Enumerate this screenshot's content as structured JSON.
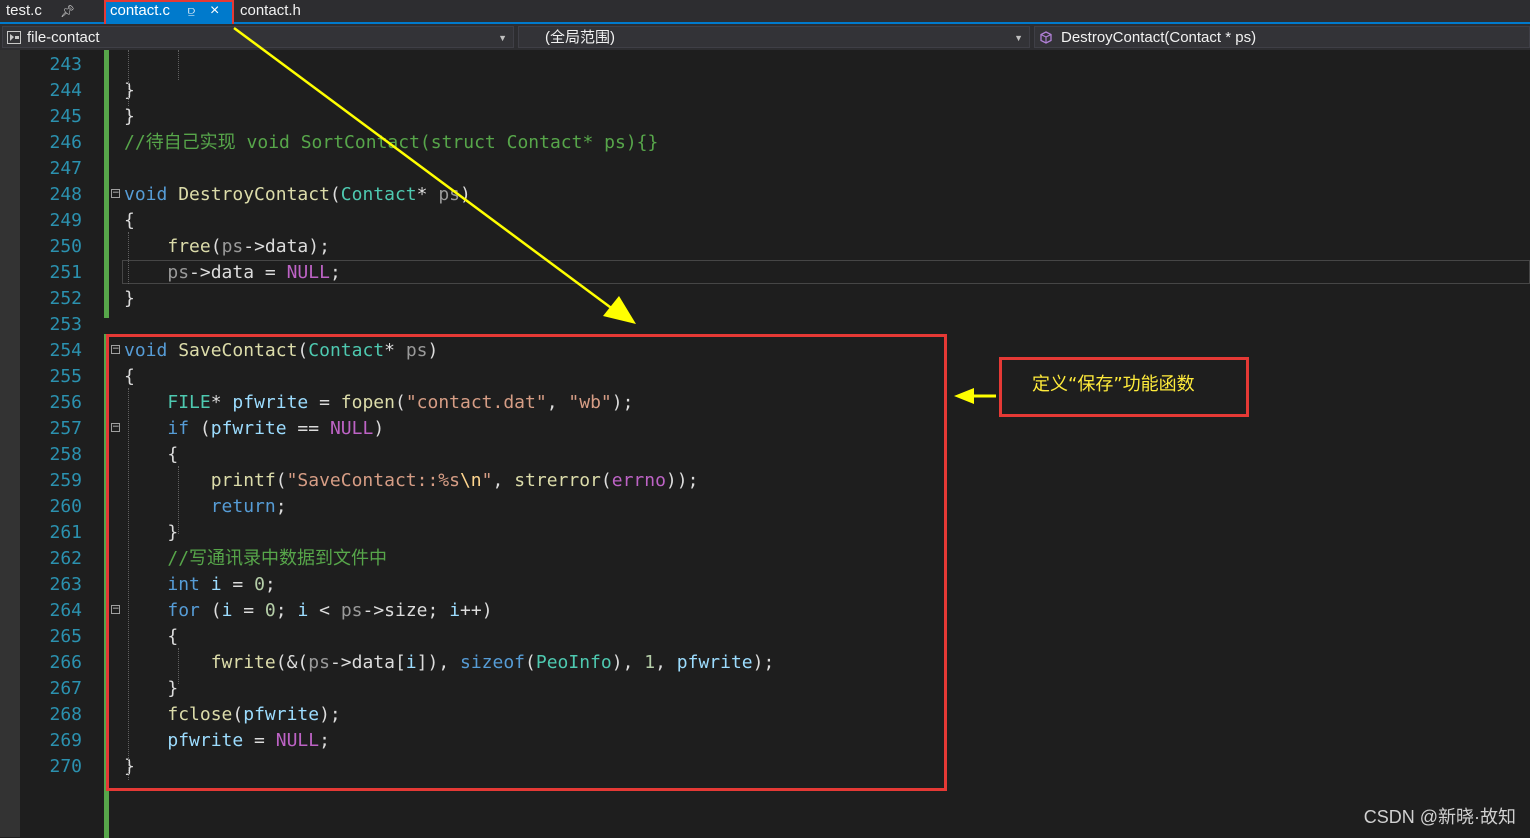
{
  "tabs": [
    {
      "label": "test.c",
      "pin": "pin-icon"
    },
    {
      "label": "contact.c",
      "pin": "pin-icon",
      "close": "×",
      "active": true
    },
    {
      "label": "contact.h"
    }
  ],
  "navbar": {
    "project": "file-contact",
    "scope": "(全局范围)",
    "member": "DestroyContact(Contact * ps)"
  },
  "annotation": {
    "callout": "定义“保存”功能函数"
  },
  "watermark": "CSDN @新晓·故知",
  "colors": {
    "accent": "#007acc",
    "highlight_box": "#e53935",
    "arrow": "#ffff00",
    "callout_text": "#ffeb3b"
  },
  "code_lines": [
    {
      "num": "243",
      "tokens": []
    },
    {
      "num": "244",
      "tokens": [
        {
          "t": "pl",
          "v": "}"
        }
      ]
    },
    {
      "num": "245",
      "tokens": [
        {
          "t": "pl",
          "v": "}"
        }
      ]
    },
    {
      "num": "246",
      "tokens": [
        {
          "t": "cm",
          "v": "//"
        },
        {
          "t": "cm",
          "v": "待自己实现",
          "cjk": true
        },
        {
          "t": "cm",
          "v": " void SortContact(struct Contact* ps){}"
        }
      ]
    },
    {
      "num": "247",
      "tokens": []
    },
    {
      "num": "248",
      "fold": true,
      "tokens": [
        {
          "t": "kw",
          "v": "void"
        },
        {
          "t": "pl",
          "v": " "
        },
        {
          "t": "fn",
          "v": "DestroyContact"
        },
        {
          "t": "pl",
          "v": "("
        },
        {
          "t": "ty",
          "v": "Contact"
        },
        {
          "t": "pl",
          "v": "* "
        },
        {
          "t": "pa",
          "v": "ps"
        },
        {
          "t": "pl",
          "v": ")"
        }
      ]
    },
    {
      "num": "249",
      "tokens": [
        {
          "t": "pl",
          "v": "{"
        }
      ]
    },
    {
      "num": "250",
      "tokens": [
        {
          "t": "pl",
          "v": "    "
        },
        {
          "t": "fn",
          "v": "free"
        },
        {
          "t": "pl",
          "v": "("
        },
        {
          "t": "pa",
          "v": "ps"
        },
        {
          "t": "pl",
          "v": "->data);"
        }
      ]
    },
    {
      "num": "251",
      "tokens": [
        {
          "t": "pl",
          "v": "    "
        },
        {
          "t": "pa",
          "v": "ps"
        },
        {
          "t": "pl",
          "v": "->data = "
        },
        {
          "t": "ma",
          "v": "NULL"
        },
        {
          "t": "pl",
          "v": ";"
        }
      ]
    },
    {
      "num": "252",
      "tokens": [
        {
          "t": "pl",
          "v": "}"
        }
      ]
    },
    {
      "num": "253",
      "tokens": []
    },
    {
      "num": "254",
      "fold": true,
      "tokens": [
        {
          "t": "kw",
          "v": "void"
        },
        {
          "t": "pl",
          "v": " "
        },
        {
          "t": "fn",
          "v": "SaveContact"
        },
        {
          "t": "pl",
          "v": "("
        },
        {
          "t": "ty",
          "v": "Contact"
        },
        {
          "t": "pl",
          "v": "* "
        },
        {
          "t": "pa",
          "v": "ps"
        },
        {
          "t": "pl",
          "v": ")"
        }
      ]
    },
    {
      "num": "255",
      "tokens": [
        {
          "t": "pl",
          "v": "{"
        }
      ]
    },
    {
      "num": "256",
      "tokens": [
        {
          "t": "pl",
          "v": "    "
        },
        {
          "t": "ty",
          "v": "FILE"
        },
        {
          "t": "pl",
          "v": "* "
        },
        {
          "t": "lv",
          "v": "pfwrite"
        },
        {
          "t": "pl",
          "v": " = "
        },
        {
          "t": "fn",
          "v": "fopen"
        },
        {
          "t": "pl",
          "v": "("
        },
        {
          "t": "st",
          "v": "\"contact.dat\""
        },
        {
          "t": "pl",
          "v": ", "
        },
        {
          "t": "st",
          "v": "\"wb\""
        },
        {
          "t": "pl",
          "v": ");"
        }
      ]
    },
    {
      "num": "257",
      "fold": true,
      "tokens": [
        {
          "t": "pl",
          "v": "    "
        },
        {
          "t": "kw",
          "v": "if"
        },
        {
          "t": "pl",
          "v": " ("
        },
        {
          "t": "lv",
          "v": "pfwrite"
        },
        {
          "t": "pl",
          "v": " == "
        },
        {
          "t": "ma",
          "v": "NULL"
        },
        {
          "t": "pl",
          "v": ")"
        }
      ]
    },
    {
      "num": "258",
      "tokens": [
        {
          "t": "pl",
          "v": "    {"
        }
      ]
    },
    {
      "num": "259",
      "tokens": [
        {
          "t": "pl",
          "v": "        "
        },
        {
          "t": "fn",
          "v": "printf"
        },
        {
          "t": "pl",
          "v": "("
        },
        {
          "t": "st",
          "v": "\"SaveContact::%s"
        },
        {
          "t": "es",
          "v": "\\n"
        },
        {
          "t": "st",
          "v": "\""
        },
        {
          "t": "pl",
          "v": ", "
        },
        {
          "t": "fn",
          "v": "strerror"
        },
        {
          "t": "pl",
          "v": "("
        },
        {
          "t": "ma",
          "v": "errno"
        },
        {
          "t": "pl",
          "v": "));"
        }
      ]
    },
    {
      "num": "260",
      "tokens": [
        {
          "t": "pl",
          "v": "        "
        },
        {
          "t": "kw",
          "v": "return"
        },
        {
          "t": "pl",
          "v": ";"
        }
      ]
    },
    {
      "num": "261",
      "tokens": [
        {
          "t": "pl",
          "v": "    }"
        }
      ]
    },
    {
      "num": "262",
      "tokens": [
        {
          "t": "pl",
          "v": "    "
        },
        {
          "t": "cm",
          "v": "//"
        },
        {
          "t": "cm",
          "v": "写通讯录中数据到文件中",
          "cjk": true
        }
      ]
    },
    {
      "num": "263",
      "tokens": [
        {
          "t": "pl",
          "v": "    "
        },
        {
          "t": "kw",
          "v": "int"
        },
        {
          "t": "pl",
          "v": " "
        },
        {
          "t": "lv",
          "v": "i"
        },
        {
          "t": "pl",
          "v": " = "
        },
        {
          "t": "nm",
          "v": "0"
        },
        {
          "t": "pl",
          "v": ";"
        }
      ]
    },
    {
      "num": "264",
      "fold": true,
      "tokens": [
        {
          "t": "pl",
          "v": "    "
        },
        {
          "t": "kw",
          "v": "for"
        },
        {
          "t": "pl",
          "v": " ("
        },
        {
          "t": "lv",
          "v": "i"
        },
        {
          "t": "pl",
          "v": " = "
        },
        {
          "t": "nm",
          "v": "0"
        },
        {
          "t": "pl",
          "v": "; "
        },
        {
          "t": "lv",
          "v": "i"
        },
        {
          "t": "pl",
          "v": " < "
        },
        {
          "t": "pa",
          "v": "ps"
        },
        {
          "t": "pl",
          "v": "->size; "
        },
        {
          "t": "lv",
          "v": "i"
        },
        {
          "t": "pl",
          "v": "++)"
        }
      ]
    },
    {
      "num": "265",
      "tokens": [
        {
          "t": "pl",
          "v": "    {"
        }
      ]
    },
    {
      "num": "266",
      "tokens": [
        {
          "t": "pl",
          "v": "        "
        },
        {
          "t": "fn",
          "v": "fwrite"
        },
        {
          "t": "pl",
          "v": "(&("
        },
        {
          "t": "pa",
          "v": "ps"
        },
        {
          "t": "pl",
          "v": "->data["
        },
        {
          "t": "lv",
          "v": "i"
        },
        {
          "t": "pl",
          "v": "]), "
        },
        {
          "t": "kw",
          "v": "sizeof"
        },
        {
          "t": "pl",
          "v": "("
        },
        {
          "t": "ty",
          "v": "PeoInfo"
        },
        {
          "t": "pl",
          "v": "), "
        },
        {
          "t": "nm",
          "v": "1"
        },
        {
          "t": "pl",
          "v": ", "
        },
        {
          "t": "lv",
          "v": "pfwrite"
        },
        {
          "t": "pl",
          "v": ");"
        }
      ]
    },
    {
      "num": "267",
      "tokens": [
        {
          "t": "pl",
          "v": "    }"
        }
      ]
    },
    {
      "num": "268",
      "tokens": [
        {
          "t": "pl",
          "v": "    "
        },
        {
          "t": "fn",
          "v": "fclose"
        },
        {
          "t": "pl",
          "v": "("
        },
        {
          "t": "lv",
          "v": "pfwrite"
        },
        {
          "t": "pl",
          "v": ");"
        }
      ]
    },
    {
      "num": "269",
      "tokens": [
        {
          "t": "pl",
          "v": "    "
        },
        {
          "t": "lv",
          "v": "pfwrite"
        },
        {
          "t": "pl",
          "v": " = "
        },
        {
          "t": "ma",
          "v": "NULL"
        },
        {
          "t": "pl",
          "v": ";"
        }
      ]
    },
    {
      "num": "270",
      "tokens": [
        {
          "t": "pl",
          "v": "}"
        }
      ]
    }
  ]
}
